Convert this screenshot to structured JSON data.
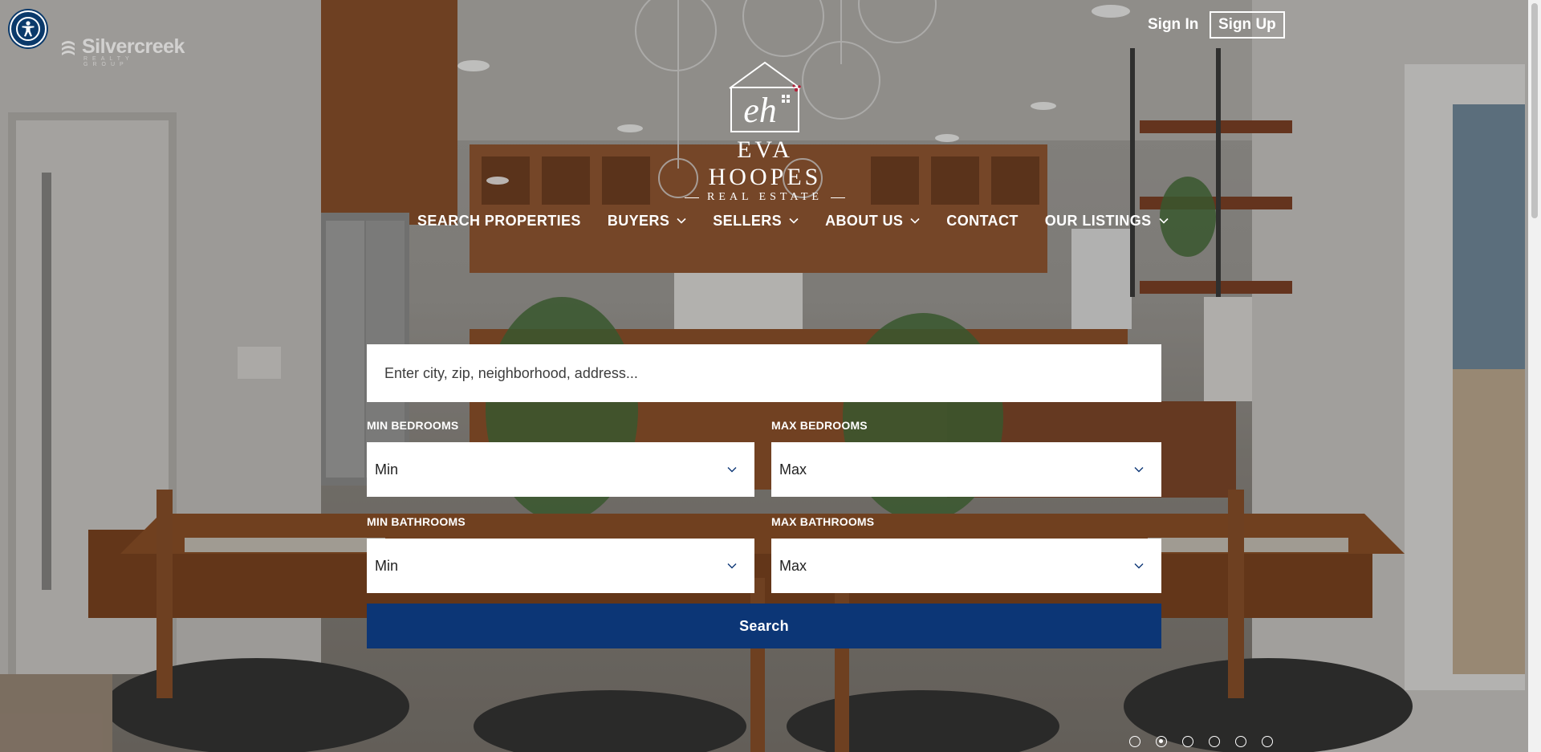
{
  "header": {
    "brand": "Silvercreek",
    "brand_sub": "REALTY GROUP",
    "sign_in": "Sign In",
    "sign_up": "Sign Up"
  },
  "logo": {
    "monogram": "eh",
    "name": "EVA HOOPES",
    "tagline": "REAL ESTATE"
  },
  "nav": {
    "items": [
      {
        "label": "SEARCH PROPERTIES",
        "dropdown": false
      },
      {
        "label": "BUYERS",
        "dropdown": true
      },
      {
        "label": "SELLERS",
        "dropdown": true
      },
      {
        "label": "ABOUT US",
        "dropdown": true
      },
      {
        "label": "CONTACT",
        "dropdown": false
      },
      {
        "label": "OUR LISTINGS",
        "dropdown": true
      }
    ]
  },
  "search": {
    "placeholder": "Enter city, zip, neighborhood, address...",
    "min_bedrooms_label": "MIN BEDROOMS",
    "min_bedrooms_value": "Min",
    "max_bedrooms_label": "MAX BEDROOMS",
    "max_bedrooms_value": "Max",
    "min_bathrooms_label": "MIN BATHROOMS",
    "min_bathrooms_value": "Min",
    "max_bathrooms_label": "MAX BATHROOMS",
    "max_bathrooms_value": "Max",
    "button": "Search"
  },
  "slider": {
    "count": 6,
    "active": 2
  },
  "colors": {
    "accent": "#0c3676",
    "a11y": "#0b3a6b"
  }
}
